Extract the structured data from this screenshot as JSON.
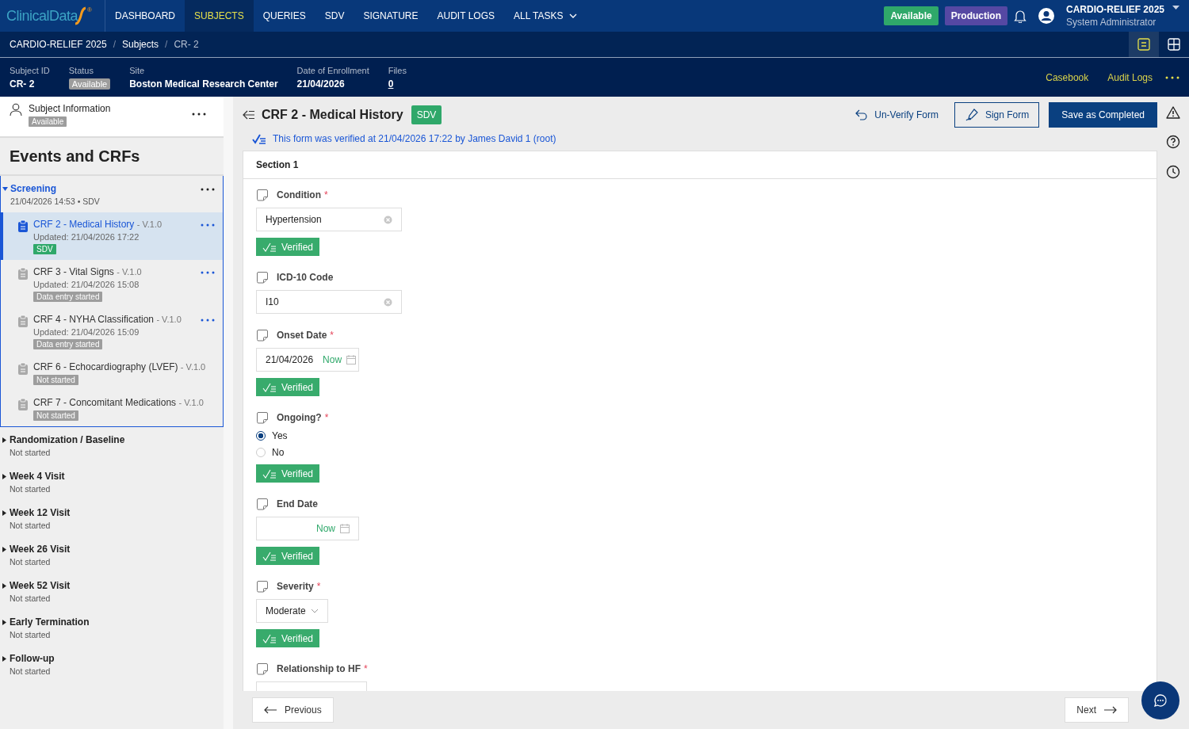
{
  "header": {
    "logo": "ClinicalData",
    "logo_mark": "®",
    "nav": [
      {
        "label": "DASHBOARD",
        "selected": false,
        "dropdown": false
      },
      {
        "label": "SUBJECTS",
        "selected": true,
        "dropdown": false
      },
      {
        "label": "QUERIES",
        "selected": false,
        "dropdown": false
      },
      {
        "label": "SDV",
        "selected": false,
        "dropdown": false
      },
      {
        "label": "SIGNATURE",
        "selected": false,
        "dropdown": false
      },
      {
        "label": "AUDIT LOGS",
        "selected": false,
        "dropdown": false
      },
      {
        "label": "ALL TASKS",
        "selected": false,
        "dropdown": true
      }
    ],
    "badges": [
      {
        "label": "Available",
        "color": "#2fa86a"
      },
      {
        "label": "Production",
        "color": "#5548a3"
      }
    ],
    "user": {
      "name": "CARDIO-RELIEF 2025",
      "role": "System Administrator"
    }
  },
  "breadcrumb": {
    "separator": "/",
    "items": [
      "CARDIO-RELIEF 2025",
      "Subjects",
      "CR- 2"
    ],
    "views": [
      {
        "kind": "list",
        "selected": true
      },
      {
        "kind": "grid",
        "selected": false
      }
    ]
  },
  "subject_bar": {
    "fields": [
      {
        "label": "Subject ID",
        "value": "CR- 2",
        "kind": "text"
      },
      {
        "label": "Status",
        "value": "Available",
        "kind": "status"
      },
      {
        "label": "Site",
        "value": "Boston Medical Research Center",
        "kind": "text"
      },
      {
        "label": "Date of Enrollment",
        "value": "21/04/2026",
        "kind": "text"
      },
      {
        "label": "Files",
        "value": "0",
        "kind": "link"
      }
    ],
    "actions": [
      "Casebook",
      "Audit Logs"
    ]
  },
  "sidebar": {
    "subject_info": {
      "title": "Subject Information",
      "status": "Available"
    },
    "heading": "Events and CRFs",
    "events": [
      {
        "name": "Screening",
        "subtitle": "21/04/2026 14:53 • SDV",
        "expanded": true,
        "selected": true,
        "crfs": [
          {
            "name": "CRF 2 - Medical History",
            "version": "- V.1.0",
            "updated": "Updated: 21/04/2026 17:22",
            "status": "SDV",
            "color": "#2fa86a",
            "selected": true,
            "menu": true
          },
          {
            "name": "CRF 3 - Vital Signs",
            "version": "- V.1.0",
            "updated": "Updated: 21/04/2026 15:08",
            "status": "Data entry started",
            "color": "#9d9d9d",
            "selected": false,
            "menu": true
          },
          {
            "name": "CRF 4 - NYHA Classification",
            "version": "- V.1.0",
            "updated": "Updated: 21/04/2026 15:09",
            "status": "Data entry started",
            "color": "#9d9d9d",
            "selected": false,
            "menu": true
          },
          {
            "name": "CRF 6 - Echocardiography (LVEF)",
            "version": "- V.1.0",
            "status": "Not started",
            "color": "#9d9d9d",
            "selected": false,
            "menu": false
          },
          {
            "name": "CRF 7 - Concomitant Medications",
            "version": "- V.1.0",
            "status": "Not started",
            "color": "#9d9d9d",
            "selected": false,
            "menu": false
          }
        ]
      },
      {
        "name": "Randomization / Baseline",
        "subtitle": "Not started",
        "expanded": false,
        "selected": false
      },
      {
        "name": "Week 4 Visit",
        "subtitle": "Not started",
        "expanded": false,
        "selected": false
      },
      {
        "name": "Week 12 Visit",
        "subtitle": "Not started",
        "expanded": false,
        "selected": false
      },
      {
        "name": "Week 26 Visit",
        "subtitle": "Not started",
        "expanded": false,
        "selected": false
      },
      {
        "name": "Week 52 Visit",
        "subtitle": "Not started",
        "expanded": false,
        "selected": false
      },
      {
        "name": "Early Termination",
        "subtitle": "Not started",
        "expanded": false,
        "selected": false
      },
      {
        "name": "Follow-up",
        "subtitle": "Not started",
        "expanded": false,
        "selected": false
      }
    ]
  },
  "form": {
    "title": "CRF 2 - Medical History",
    "badge": "SDV",
    "actions": [
      {
        "label": "Un-Verify Form",
        "kind": "link"
      },
      {
        "label": "Sign Form",
        "kind": "outline"
      },
      {
        "label": "Save as Completed",
        "kind": "primary"
      }
    ],
    "verified_note": "This form was verified at 21/04/2026 17:22 by James David 1 (root)",
    "section": "Section 1",
    "fields": [
      {
        "kind": "text",
        "label": "Condition",
        "required_mark": "*",
        "value": "Hypertension",
        "verified": "Verified"
      },
      {
        "kind": "text",
        "label": "ICD-10 Code",
        "value": "I10"
      },
      {
        "kind": "date",
        "label": "Onset Date",
        "required_mark": "*",
        "value": "21/04/2026",
        "now": "Now",
        "verified": "Verified"
      },
      {
        "kind": "radio",
        "label": "Ongoing?",
        "required_mark": "*",
        "options": [
          {
            "label": "Yes",
            "selected": true
          },
          {
            "label": "No",
            "selected": false
          }
        ],
        "verified": "Verified"
      },
      {
        "kind": "date",
        "label": "End Date",
        "now": "Now",
        "verified": "Verified"
      },
      {
        "kind": "select",
        "label": "Severity",
        "required_mark": "*",
        "value": "Moderate",
        "verified": "Verified"
      },
      {
        "kind": "select",
        "label": "Relationship to HF",
        "required_mark": "*"
      }
    ],
    "previous": "Previous",
    "next": "Next"
  }
}
